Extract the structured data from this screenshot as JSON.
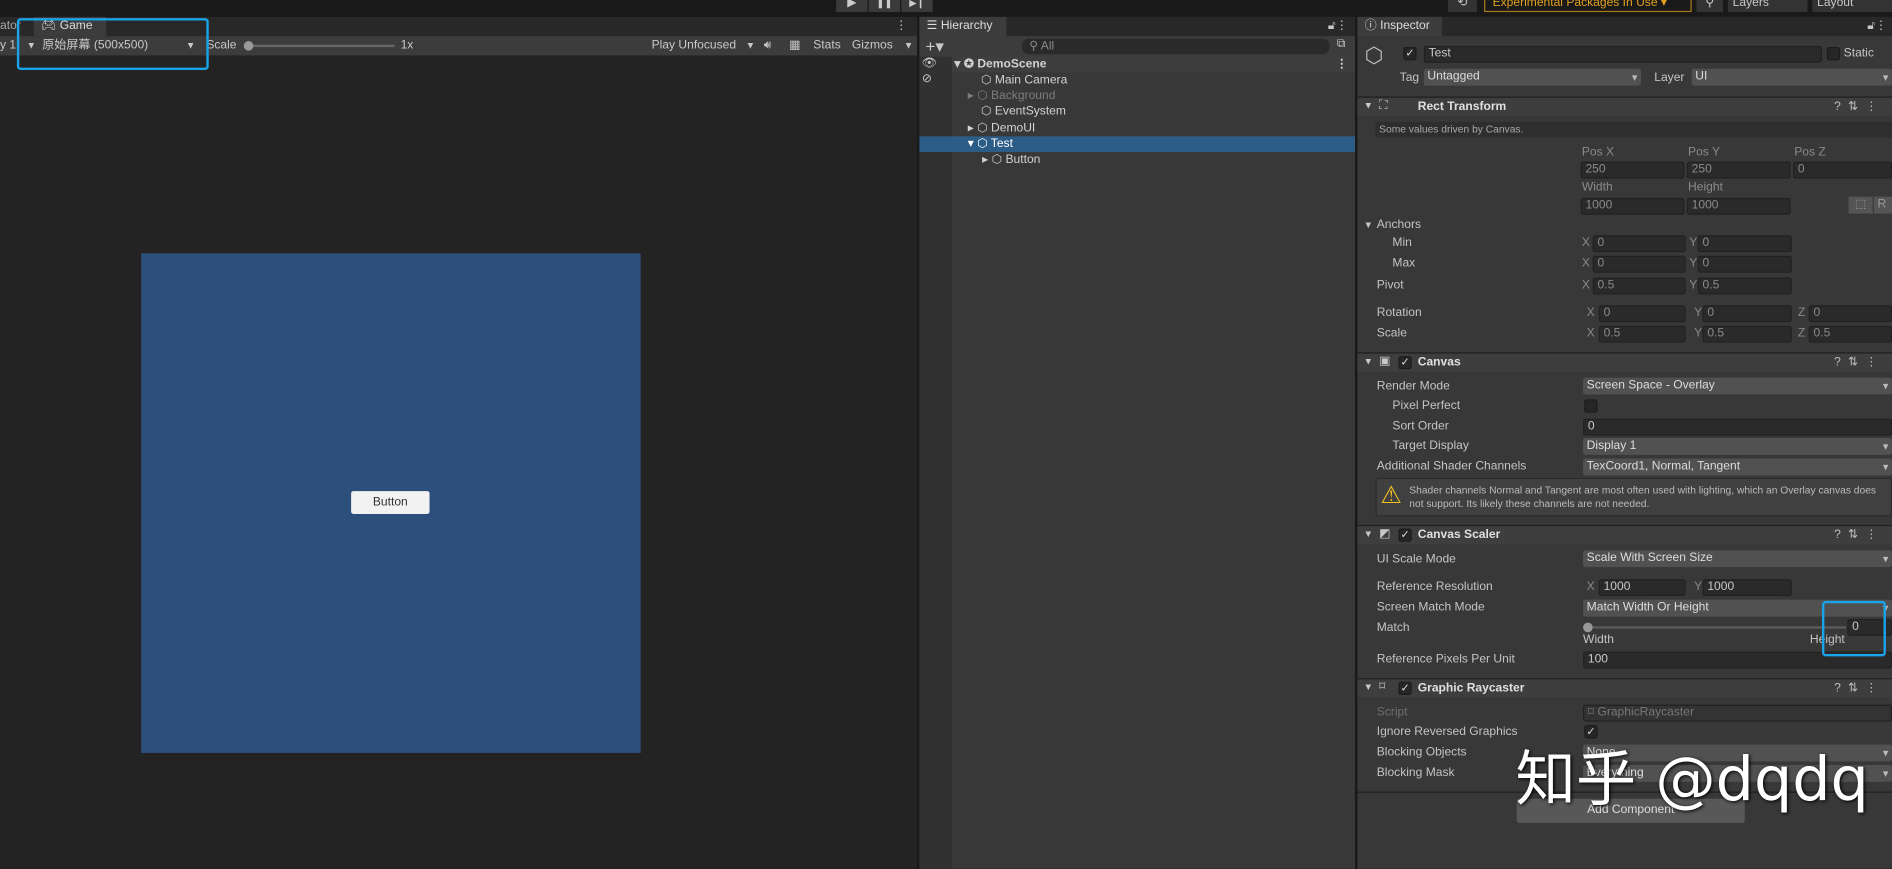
{
  "toolbar": {
    "play": "▶",
    "pause": "❚❚",
    "step": "▶❙",
    "experimental": "Experimental Packages In Use ▾",
    "layers": "Layers",
    "layout": "Layout",
    "history_icon": "history-icon",
    "search_icon": "search-icon"
  },
  "game": {
    "prev_tab": "ator",
    "tab": "Game",
    "display": "y 1",
    "resolution": "原始屏幕 (500x500)",
    "scale_label": "Scale",
    "scale_value": "1x",
    "play_mode": "Play Unfocused",
    "stats": "Stats",
    "gizmos": "Gizmos",
    "button_label": "Button",
    "canvas_color": "#2c4f7c"
  },
  "hierarchy": {
    "title": "Hierarchy",
    "search_placeholder": "All",
    "items": [
      {
        "label": "DemoScene"
      },
      {
        "label": "Main Camera"
      },
      {
        "label": "Background"
      },
      {
        "label": "EventSystem"
      },
      {
        "label": "DemoUI"
      },
      {
        "label": "Test"
      },
      {
        "label": "Button"
      }
    ]
  },
  "inspector": {
    "title": "Inspector",
    "name": "Test",
    "static": "Static",
    "tag_label": "Tag",
    "tag": "Untagged",
    "layer_label": "Layer",
    "layer": "UI",
    "rect": {
      "title": "Rect Transform",
      "note": "Some values driven by Canvas.",
      "posx_l": "Pos X",
      "posy_l": "Pos Y",
      "posz_l": "Pos Z",
      "posx": "250",
      "posy": "250",
      "posz": "0",
      "width_l": "Width",
      "height_l": "Height",
      "width": "1000",
      "height": "1000",
      "r": "R",
      "anchors": "Anchors",
      "min": "Min",
      "max": "Max",
      "pivot": "Pivot",
      "rotation": "Rotation",
      "scale": "Scale",
      "x": "X",
      "y": "Y",
      "z": "Z",
      "min_x": "0",
      "min_y": "0",
      "max_x": "0",
      "max_y": "0",
      "pivot_x": "0.5",
      "pivot_y": "0.5",
      "rot_x": "0",
      "rot_y": "0",
      "rot_z": "0",
      "scale_x": "0.5",
      "scale_y": "0.5",
      "scale_z": "0.5"
    },
    "canvas": {
      "title": "Canvas",
      "render_mode_l": "Render Mode",
      "render_mode": "Screen Space - Overlay",
      "pixel_perfect_l": "Pixel Perfect",
      "sort_order_l": "Sort Order",
      "sort_order": "0",
      "target_display_l": "Target Display",
      "target_display": "Display 1",
      "shader_l": "Additional Shader Channels",
      "shader": "TexCoord1, Normal, Tangent",
      "warning": "Shader channels Normal and Tangent are most often used with lighting, which an Overlay canvas does not support. Its likely these channels are not needed."
    },
    "scaler": {
      "title": "Canvas Scaler",
      "ui_scale_l": "UI Scale Mode",
      "ui_scale": "Scale With Screen Size",
      "ref_res_l": "Reference Resolution",
      "ref_x": "1000",
      "ref_y": "1000",
      "match_mode_l": "Screen Match Mode",
      "match_mode": "Match Width Or Height",
      "match_l": "Match",
      "match": "0",
      "width_l": "Width",
      "height_l": "Height",
      "ppu_l": "Reference Pixels Per Unit",
      "ppu": "100"
    },
    "raycaster": {
      "title": "Graphic Raycaster",
      "script_l": "Script",
      "script": "⌑ GraphicRaycaster",
      "ignore_l": "Ignore Reversed Graphics",
      "blocking_obj_l": "Blocking Objects",
      "blocking_obj": "None",
      "blocking_mask_l": "Blocking Mask",
      "blocking_mask": "Everything"
    },
    "add_component": "Add Component"
  },
  "watermark": "知乎 @dqdq",
  "highlight_color": "#1aa3e8"
}
